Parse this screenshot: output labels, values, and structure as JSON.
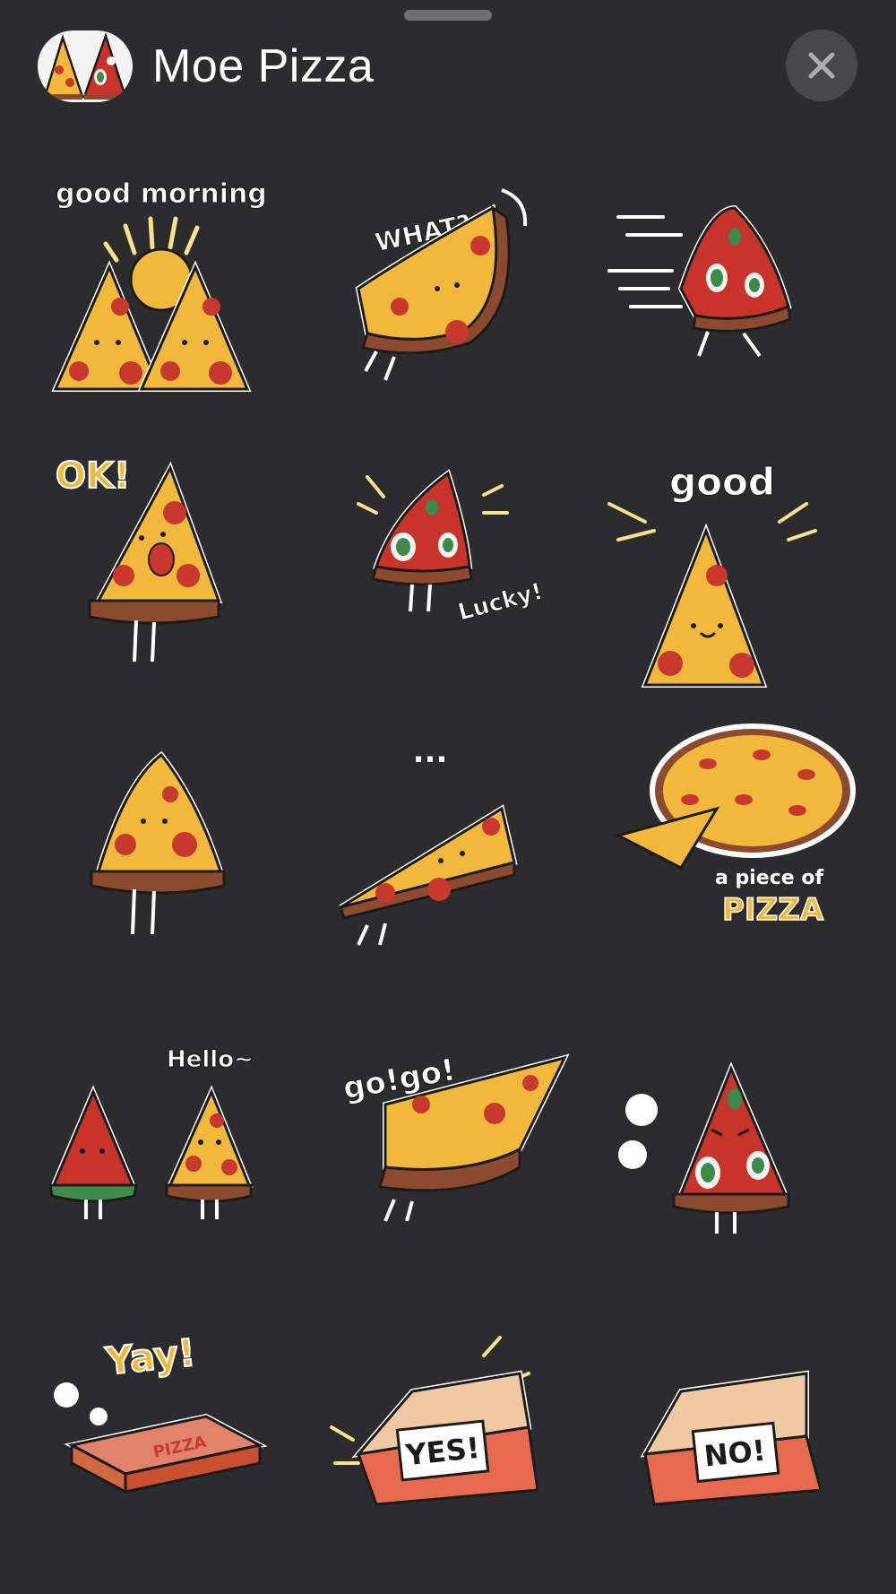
{
  "header": {
    "title": "Moe Pizza",
    "pack_icon": "pizza-pair-icon",
    "close_icon": "close-icon"
  },
  "colors": {
    "background": "#2c2c2e",
    "crust": "#8c4a2f",
    "cheese": "#f2b83c",
    "pepperoni": "#c8382e",
    "sauce": "#c8332a",
    "basil": "#3d8a4a",
    "accent_yellow": "#f7e18e",
    "outline": "#1c1c1c"
  },
  "stickers": [
    {
      "name": "good-morning",
      "text": "good morning"
    },
    {
      "name": "what",
      "text": "WHAT?"
    },
    {
      "name": "running",
      "text": ""
    },
    {
      "name": "ok",
      "text": "OK!"
    },
    {
      "name": "lucky",
      "text": "Lucky!"
    },
    {
      "name": "good",
      "text": "good"
    },
    {
      "name": "bitten",
      "text": ""
    },
    {
      "name": "ellipsis",
      "text": "..."
    },
    {
      "name": "a-piece-of-pizza",
      "text": "a piece of",
      "text2": "PIZZA"
    },
    {
      "name": "hello",
      "text": "Hello~"
    },
    {
      "name": "go-go",
      "text": "go!go!"
    },
    {
      "name": "angry",
      "text": ""
    },
    {
      "name": "yay",
      "text": "Yay!",
      "text2": "PIZZA"
    },
    {
      "name": "yes-box",
      "text": "YES!"
    },
    {
      "name": "no-box",
      "text": "NO!"
    }
  ]
}
